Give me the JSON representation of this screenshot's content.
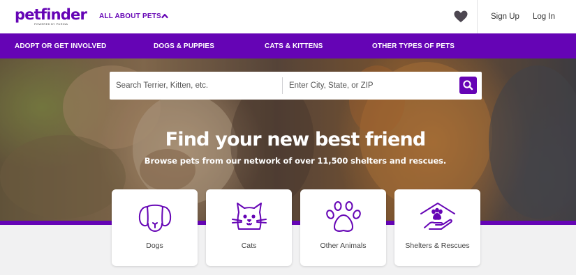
{
  "header": {
    "logo_text": "petfinder",
    "logo_subtext": "POWERED BY PURINA",
    "about_label": "ALL ABOUT PETS",
    "about_icon": "chevron-up-icon",
    "favorites_icon": "heart-icon",
    "signup_label": "Sign Up",
    "login_label": "Log In"
  },
  "nav": {
    "items": [
      {
        "label": "ADOPT OR GET INVOLVED"
      },
      {
        "label": "DOGS & PUPPIES"
      },
      {
        "label": "CATS & KITTENS"
      },
      {
        "label": "OTHER TYPES OF PETS"
      }
    ]
  },
  "hero": {
    "search": {
      "animal_placeholder": "Search Terrier, Kitten, etc.",
      "location_placeholder": "Enter City, State, or ZIP",
      "button_icon": "search-icon"
    },
    "headline": "Find your new best friend",
    "subheadline": "Browse pets from our network of over 11,500 shelters and rescues."
  },
  "categories": [
    {
      "label": "Dogs",
      "icon": "dog-icon"
    },
    {
      "label": "Cats",
      "icon": "cat-icon"
    },
    {
      "label": "Other Animals",
      "icon": "paw-icon"
    },
    {
      "label": "Shelters & Rescues",
      "icon": "shelter-icon"
    }
  ],
  "colors": {
    "brand_purple": "#6504b5",
    "page_background": "#f1f1f2",
    "white": "#ffffff"
  }
}
